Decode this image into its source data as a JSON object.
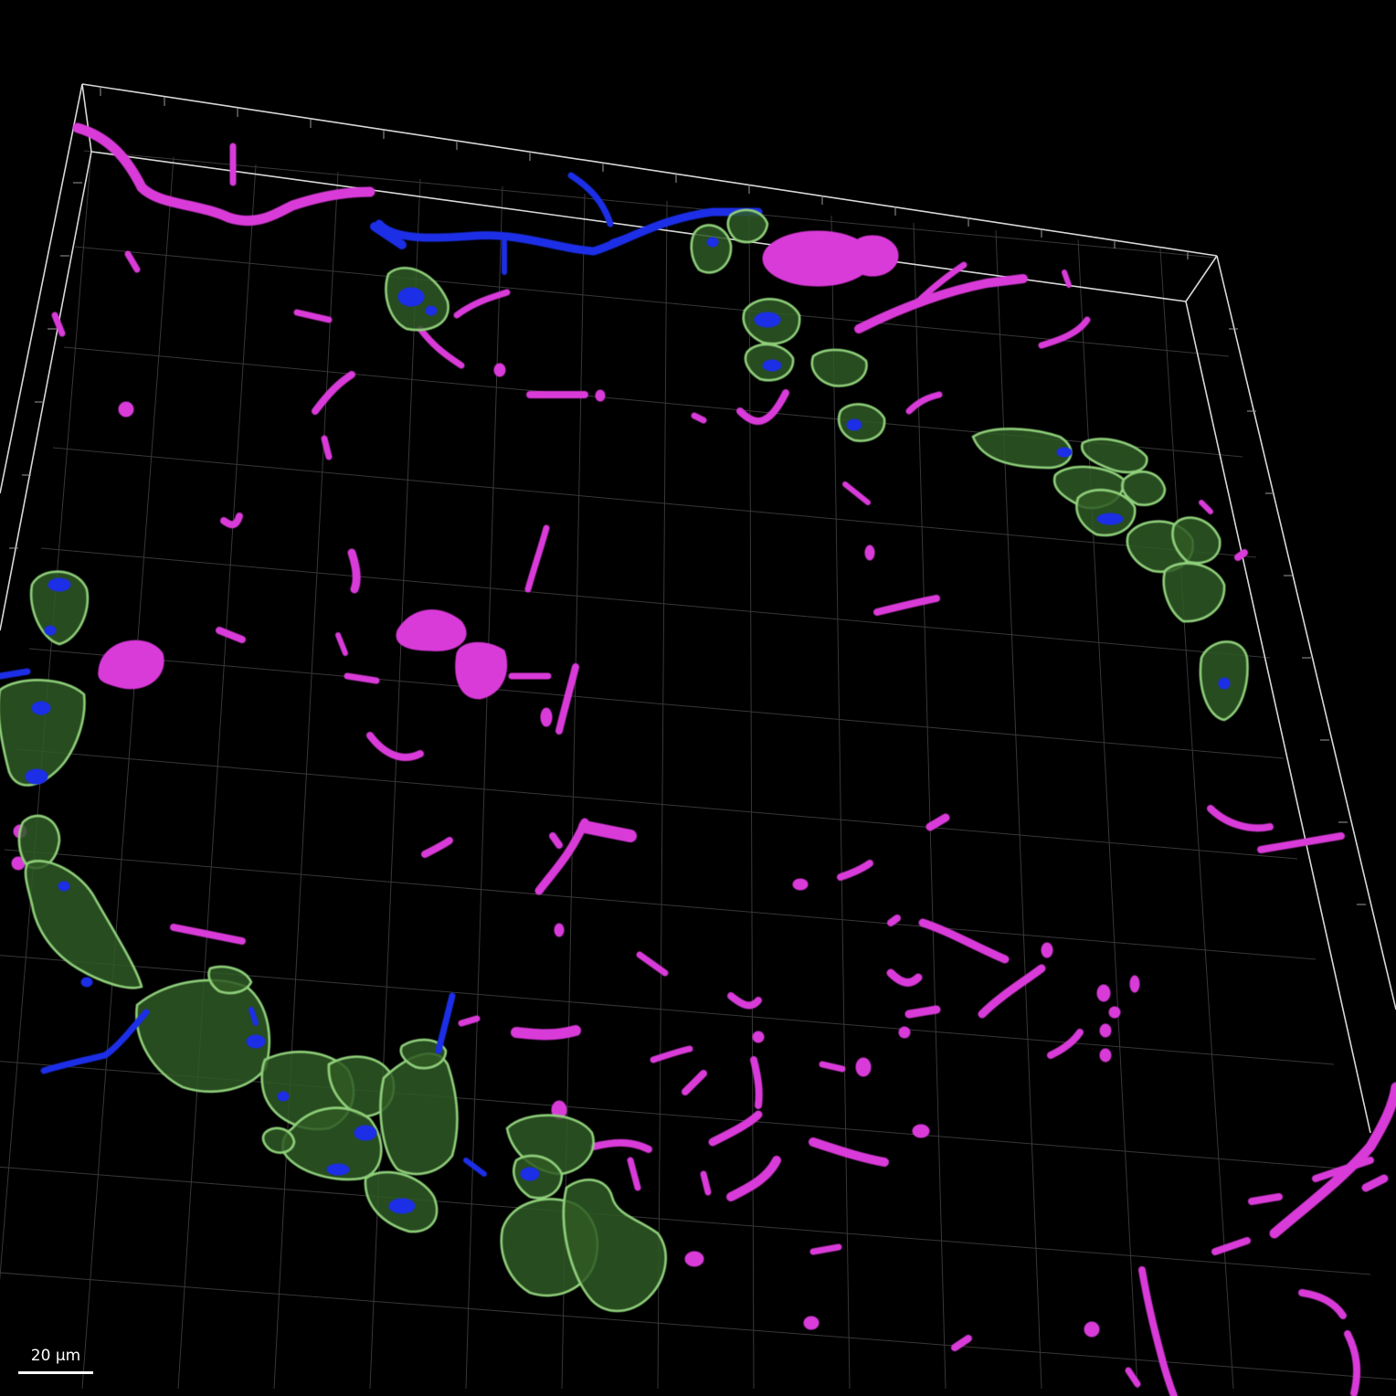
{
  "scale_bar": {
    "label": "20 µm"
  },
  "colors": {
    "background": "#000000",
    "grid": "#5a5a5a",
    "box_edge": "#d8d8d8",
    "magenta": "#d93ad9",
    "green_fill": "#2e5a23",
    "green_edge": "#8fd07a",
    "blue": "#1a2ee6"
  },
  "channels": [
    {
      "name": "magenta-structures-icon"
    },
    {
      "name": "green-cells-icon"
    },
    {
      "name": "blue-structures-icon"
    }
  ]
}
